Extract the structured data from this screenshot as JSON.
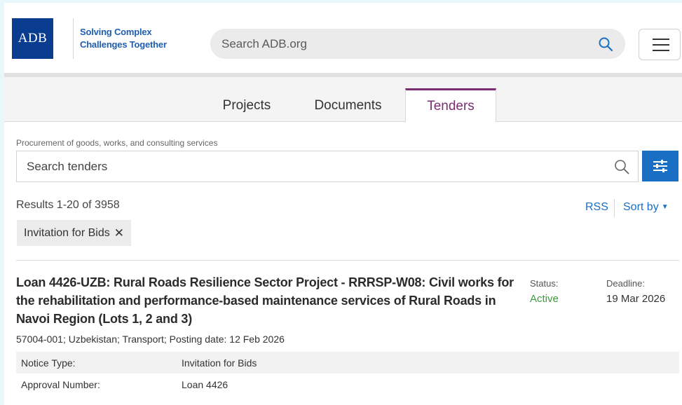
{
  "header": {
    "logo_text": "ADB",
    "tagline_line1": "Solving Complex",
    "tagline_line2": "Challenges Together",
    "search_placeholder": "Search ADB.org"
  },
  "tabs": [
    {
      "label": "Projects",
      "active": false
    },
    {
      "label": "Documents",
      "active": false
    },
    {
      "label": "Tenders",
      "active": true
    }
  ],
  "tender_search": {
    "label": "Procurement of goods, works, and consulting services",
    "placeholder": "Search tenders"
  },
  "results": {
    "count_text": "Results 1-20 of 3958",
    "rss_label": "RSS",
    "sort_label": "Sort by"
  },
  "filters": [
    {
      "label": "Invitation for Bids"
    }
  ],
  "items": [
    {
      "title": "Loan 4426-UZB: Rural Roads Resilience Sector Project - RRRSP-W08: Civil works for the rehabilitation and performance-based maintenance services of Rural Roads in Navoi Region (Lots 1, 2 and 3)",
      "status_label": "Status:",
      "status_value": "Active",
      "deadline_label": "Deadline:",
      "deadline_value": "19 Mar 2026",
      "meta": "57004-001; Uzbekistan; Transport; Posting date: 12 Feb 2026",
      "details": [
        {
          "key": "Notice Type:",
          "value": "Invitation for Bids"
        },
        {
          "key": "Approval Number:",
          "value": "Loan 4426"
        }
      ]
    }
  ],
  "colors": {
    "brand_blue": "#0a3d8f",
    "link_blue": "#1a6fc4",
    "active_tab": "#7b2d72",
    "status_active": "#3a9a3a"
  }
}
